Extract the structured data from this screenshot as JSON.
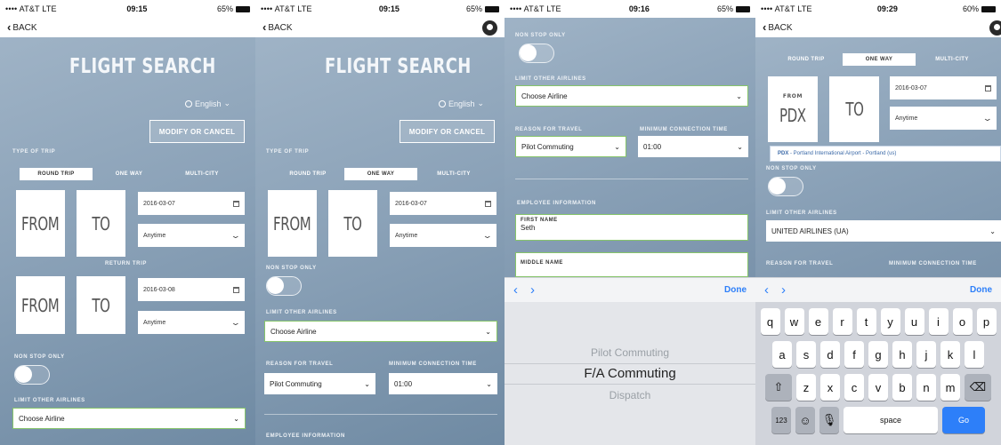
{
  "screens": [
    {
      "status": {
        "carrier": "•••• AT&T  LTE",
        "time": "09:15",
        "battery": "65%"
      },
      "nav": {
        "back": "BACK"
      },
      "title": "FLIGHT SEARCH",
      "language": "English",
      "modify_button": "MODIFY OR CANCEL",
      "type_of_trip_label": "TYPE OF TRIP",
      "tabs": [
        "ROUND TRIP",
        "ONE WAY",
        "MULTI-CITY"
      ],
      "from": "FROM",
      "to": "TO",
      "date1": "2016-03-07",
      "time1": "Anytime",
      "return_label": "RETURN TRIP",
      "date2": "2016-03-08",
      "time2": "Anytime",
      "nonstop_label": "NON STOP ONLY",
      "limit_label": "LIMIT OTHER AIRLINES",
      "airline": "Choose Airline"
    },
    {
      "status": {
        "carrier": "•••• AT&T  LTE",
        "time": "09:15",
        "battery": "65%"
      },
      "nav": {
        "back": "BACK"
      },
      "title": "FLIGHT SEARCH",
      "language": "English",
      "modify_button": "MODIFY OR CANCEL",
      "type_of_trip_label": "TYPE OF TRIP",
      "tabs": [
        "ROUND TRIP",
        "ONE WAY",
        "MULTI-CITY"
      ],
      "from": "FROM",
      "to": "TO",
      "date1": "2016-03-07",
      "time1": "Anytime",
      "nonstop_label": "NON STOP ONLY",
      "limit_label": "LIMIT OTHER AIRLINES",
      "airline": "Choose Airline",
      "reason_label": "REASON FOR TRAVEL",
      "reason": "Pilot Commuting",
      "min_conn_label": "MINIMUM CONNECTION TIME",
      "min_conn": "01:00",
      "employee_label": "EMPLOYEE INFORMATION"
    },
    {
      "status": {
        "carrier": "•••• AT&T  LTE",
        "time": "09:16",
        "battery": "65%"
      },
      "nonstop_label": "NON STOP ONLY",
      "limit_label": "LIMIT OTHER AIRLINES",
      "airline": "Choose Airline",
      "reason_label": "REASON FOR TRAVEL",
      "reason": "Pilot Commuting",
      "min_conn_label": "MINIMUM CONNECTION TIME",
      "min_conn": "01:00",
      "employee_label": "EMPLOYEE INFORMATION",
      "first_name_label": "FIRST NAME",
      "first_name": "Seth",
      "middle_name_label": "MIDDLE NAME",
      "done": "Done",
      "picker": [
        "Pilot Commuting",
        "F/A Commuting",
        "Dispatch"
      ]
    },
    {
      "status": {
        "carrier": "•••• AT&T  LTE",
        "time": "09:29",
        "battery": "60%"
      },
      "nav": {
        "back": "BACK"
      },
      "tabs": [
        "ROUND TRIP",
        "ONE WAY",
        "MULTI-CITY"
      ],
      "from_label": "FROM",
      "from_code": "PDX",
      "to": "TO",
      "date1": "2016-03-07",
      "time1": "Anytime",
      "suggestion_code": "PDX",
      "suggestion_rest": " - Portland International Airport - Portland (us)",
      "nonstop_label": "NON STOP ONLY",
      "limit_label": "LIMIT OTHER AIRLINES",
      "airline": "UNITED AIRLINES (UA)",
      "reason_label": "REASON FOR TRAVEL",
      "min_conn_label": "MINIMUM CONNECTION TIME",
      "done": "Done",
      "keyboard": {
        "row1": [
          "q",
          "w",
          "e",
          "r",
          "t",
          "y",
          "u",
          "i",
          "o",
          "p"
        ],
        "row2": [
          "a",
          "s",
          "d",
          "f",
          "g",
          "h",
          "j",
          "k",
          "l"
        ],
        "row3": [
          "z",
          "x",
          "c",
          "v",
          "b",
          "n",
          "m"
        ],
        "numbers": "123",
        "space": "space",
        "go": "Go"
      }
    }
  ]
}
